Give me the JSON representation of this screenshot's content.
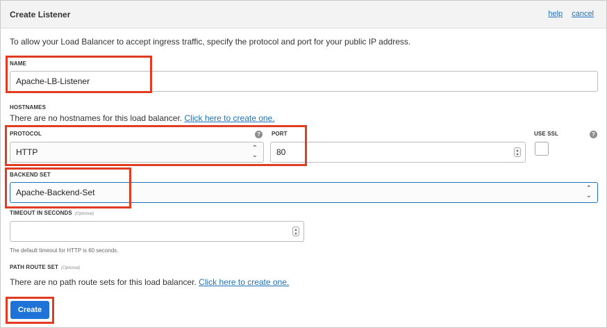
{
  "header": {
    "title": "Create Listener",
    "help_label": "help",
    "cancel_label": "cancel"
  },
  "intro": "To allow your Load Balancer to accept ingress traffic, specify the protocol and port for your public IP address.",
  "name": {
    "label": "NAME",
    "value": "Apache-LB-Listener"
  },
  "hostnames": {
    "label": "HOSTNAMES",
    "text": "There are no hostnames for this load balancer.",
    "link": "Click here to create one."
  },
  "protocol": {
    "label": "PROTOCOL",
    "value": "HTTP"
  },
  "port": {
    "label": "PORT",
    "value": "80"
  },
  "use_ssl": {
    "label": "USE SSL",
    "checked": false
  },
  "backend_set": {
    "label": "BACKEND SET",
    "value": "Apache-Backend-Set"
  },
  "timeout": {
    "label": "TIMEOUT IN SECONDS",
    "optional": "(Optional)",
    "value": "",
    "hint": "The default timeout for HTTP is 60 seconds."
  },
  "path_route_set": {
    "label": "PATH ROUTE SET",
    "optional": "(Optional)",
    "text": "There are no path route sets for this load balancer.",
    "link": "Click here to create one."
  },
  "create_button": "Create",
  "icons": {
    "help": "question-circle-icon",
    "select_arrows": "up-down-chevron-icon"
  },
  "colors": {
    "accent": "#1f72d6",
    "link": "#1f72b9",
    "highlight": "#e33b22"
  }
}
